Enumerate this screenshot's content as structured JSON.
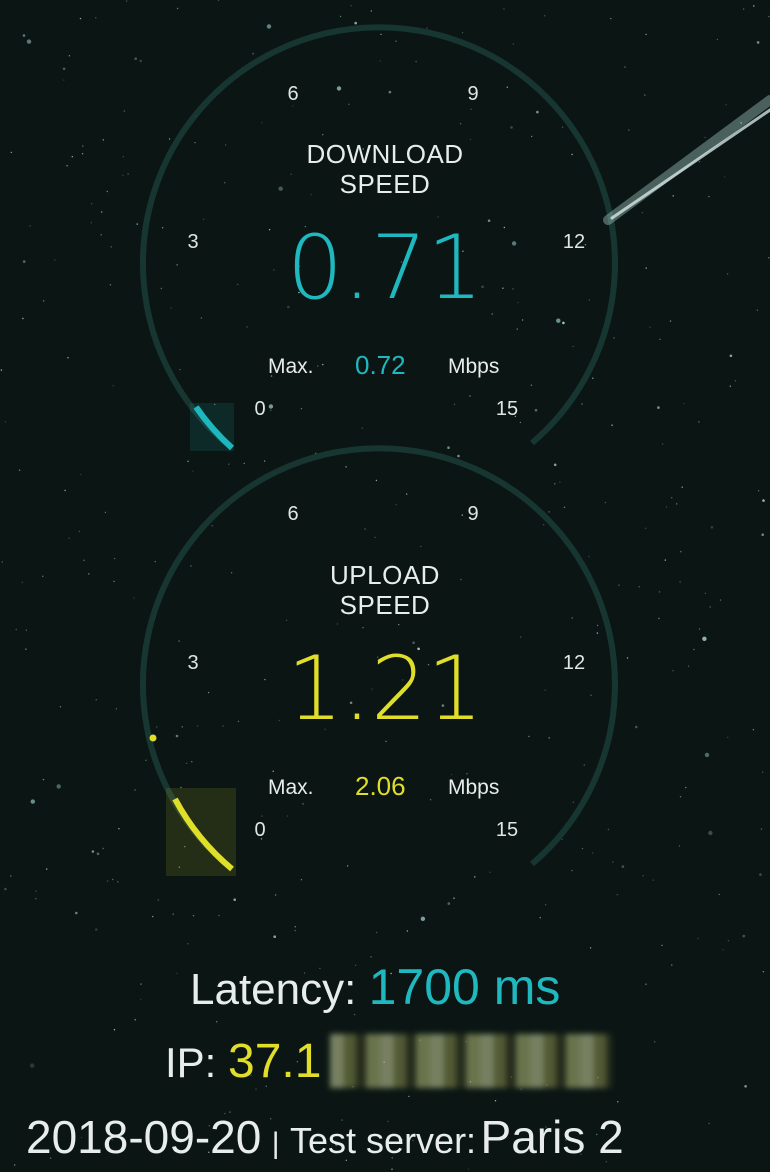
{
  "download": {
    "title_line1": "DOWNLOAD",
    "title_line2": "SPEED",
    "value": "0.71",
    "max_label": "Max.",
    "max_value": "0.72",
    "unit": "Mbps",
    "ticks": [
      "0",
      "3",
      "6",
      "9",
      "12",
      "15"
    ],
    "accent": "#1fb8bf"
  },
  "upload": {
    "title_line1": "UPLOAD",
    "title_line2": "SPEED",
    "value": "1.21",
    "max_label": "Max.",
    "max_value": "2.06",
    "unit": "Mbps",
    "ticks": [
      "0",
      "3",
      "6",
      "9",
      "12",
      "15"
    ],
    "accent": "#e0de2a"
  },
  "latency": {
    "label": "Latency:",
    "value": "1700 ms"
  },
  "ip": {
    "label": "IP:",
    "value": "37.1"
  },
  "footer": {
    "date": "2018-09-20",
    "separator": "|",
    "server_label": "Test server:",
    "server_name": "Paris 2"
  }
}
